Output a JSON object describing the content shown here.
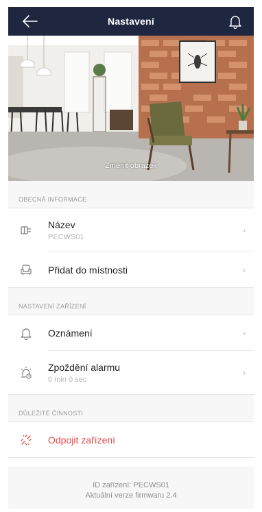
{
  "header": {
    "title": "Nastavení",
    "back_icon": "back-arrow-icon",
    "bell_icon": "bell-icon",
    "bg_color": "#1f2640"
  },
  "hero": {
    "caption": "Změnit obrázek"
  },
  "sections": {
    "general": {
      "header": "OBECNÁ INFORMACE",
      "name_label": "Název",
      "name_value": "PECWS01",
      "room_label": "Přidat do místnosti"
    },
    "device": {
      "header": "NASTAVENÍ ZAŘÍZENÍ",
      "notifications_label": "Oznámení",
      "delay_label": "Zpoždění alarmu",
      "delay_value": "0 min 0 sec"
    },
    "actions": {
      "header": "DŮLEŽITÉ ČINNOSTI",
      "unpair_label": "Odpojit zařízení",
      "danger_color": "#e24a4a"
    }
  },
  "footer": {
    "device_id": "ID zařízení: PECWS01",
    "firmware": "Aktuální verze firmwaru 2.4"
  }
}
